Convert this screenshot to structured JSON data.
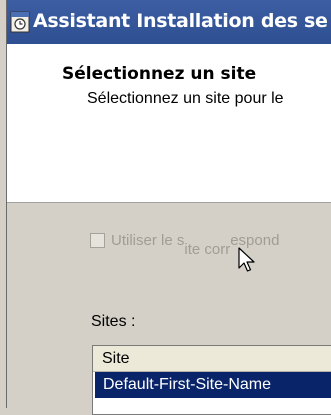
{
  "window": {
    "title": "Assistant Installation des se",
    "icon": "wizard-icon"
  },
  "header": {
    "title": "Sélectionnez un site",
    "subtitle": "Sélectionnez un site pour le"
  },
  "checkbox": {
    "checked": false,
    "label_start": "Utiliser le s",
    "label_drop": "ite corr",
    "label_end": "espond"
  },
  "sites": {
    "label": "Sites :",
    "column_header": "Site",
    "rows": [
      "Default-First-Site-Name"
    ],
    "selected_color": "#0a246a"
  },
  "colors": {
    "titlebar": "#2e4f91",
    "dialog_bg": "#d4d0c8",
    "disabled_text": "#a09d95"
  }
}
